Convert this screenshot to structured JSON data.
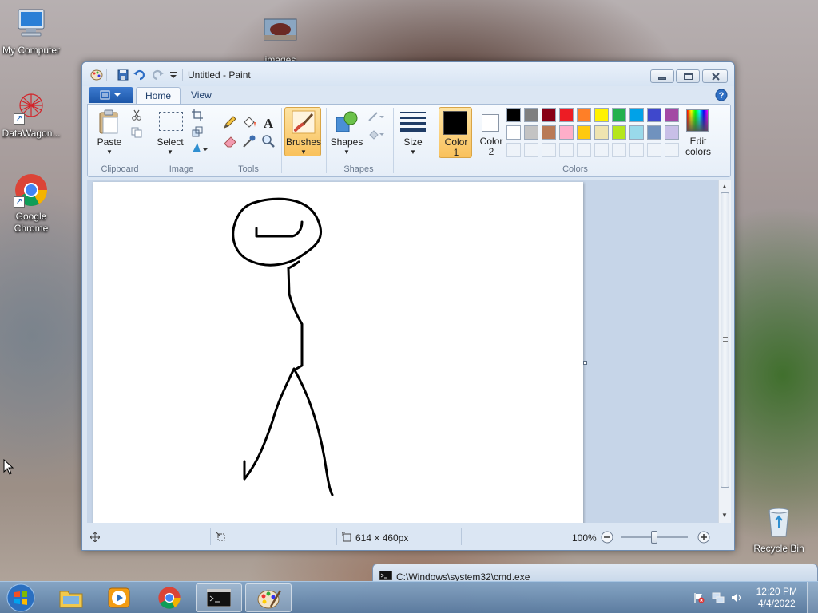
{
  "desktop": {
    "icons": [
      {
        "label": "My Computer"
      },
      {
        "label": "images"
      },
      {
        "label": "DataWagon..."
      },
      {
        "label": "Google\nChrome"
      },
      {
        "label": "Recycle Bin"
      }
    ]
  },
  "paint": {
    "title": "Untitled - Paint",
    "tabs": {
      "home": "Home",
      "view": "View"
    },
    "ribbon": {
      "paste": "Paste",
      "select": "Select",
      "brushes": "Brushes",
      "shapes": "Shapes",
      "size": "Size",
      "color1": "Color\n1",
      "color2": "Color\n2",
      "edit_colors": "Edit\ncolors",
      "groups": {
        "clipboard": "Clipboard",
        "image": "Image",
        "tools": "Tools",
        "shapes": "Shapes",
        "colors": "Colors"
      }
    },
    "palette_row1": [
      "#000000",
      "#7f7f7f",
      "#880015",
      "#ed1c24",
      "#ff7f27",
      "#fff200",
      "#22b14c",
      "#00a2e8",
      "#3f48cc",
      "#a349a4"
    ],
    "palette_row2": [
      "#ffffff",
      "#c3c3c3",
      "#b97a57",
      "#ffaec9",
      "#ffc90e",
      "#efe4b0",
      "#b5e61d",
      "#99d9ea",
      "#7092be",
      "#c8bfe7"
    ],
    "color1_value": "#000000",
    "color2_value": "#ffffff",
    "status": {
      "dimensions": "614 × 460px",
      "zoom": "100%"
    }
  },
  "cmd": {
    "title": "C:\\Windows\\system32\\cmd.exe"
  },
  "taskbar": {
    "time": "12:20 PM",
    "date": "4/4/2022"
  }
}
